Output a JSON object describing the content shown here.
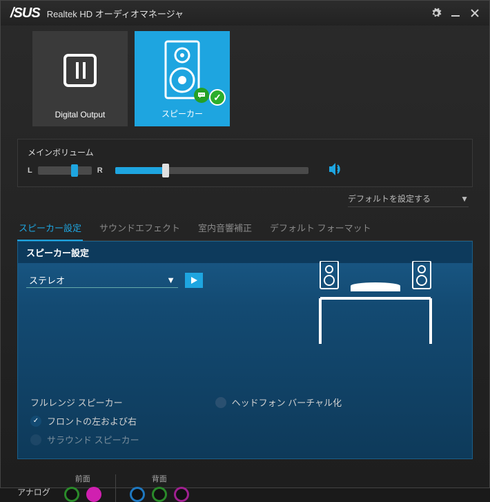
{
  "titlebar": {
    "logo": "/SUS",
    "title": "Realtek HD オーディオマネージャ"
  },
  "devices": [
    {
      "label": "Digital Output",
      "active": false
    },
    {
      "label": "スピーカー",
      "active": true
    }
  ],
  "main_volume": {
    "label": "メインボリューム",
    "l": "L",
    "r": "R"
  },
  "default_select": "デフォルトを設定する",
  "tabs": [
    {
      "label": "スピーカー設定",
      "active": true
    },
    {
      "label": "サウンドエフェクト",
      "active": false
    },
    {
      "label": "室内音響補正",
      "active": false
    },
    {
      "label": "デフォルト フォーマット",
      "active": false
    }
  ],
  "panel": {
    "title": "スピーカー設定",
    "config_value": "ステレオ",
    "fullrange_label": "フルレンジ スピーカー",
    "front_lr_label": "フロントの左および右",
    "surround_label": "サラウンド スピーカー",
    "headphone_virt_label": "ヘッドフォン バーチャル化"
  },
  "ports": {
    "analog_label": "アナログ",
    "front_label": "前面",
    "back_label": "背面",
    "front_ports": [
      {
        "color": "#2a8a2a"
      },
      {
        "color": "#d020b0",
        "filled": true
      }
    ],
    "back_ports": [
      {
        "color": "#1e78c0"
      },
      {
        "color": "#2a8a2a"
      },
      {
        "color": "#a02090"
      }
    ]
  }
}
